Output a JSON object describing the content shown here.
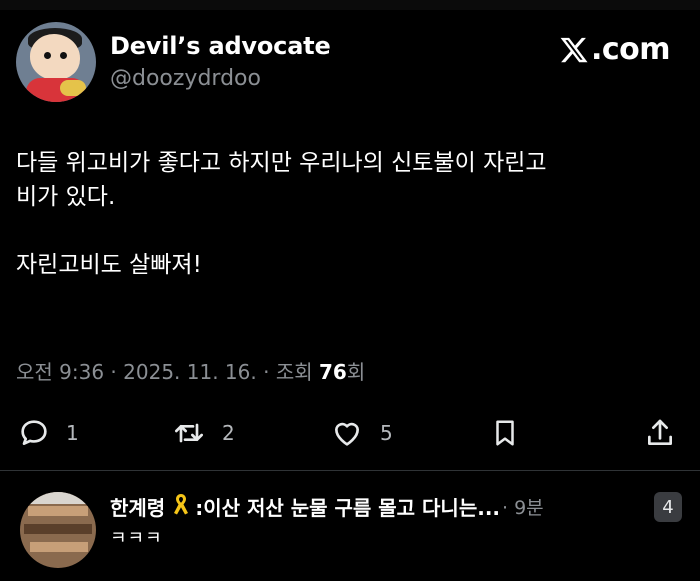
{
  "author": {
    "display_name": "Devil’s advocate",
    "handle": "@doozydrdoo"
  },
  "brand": {
    "logo": "x-logo-icon",
    "suffix": ".com"
  },
  "tweet": {
    "lines": [
      "다들 위고비가 좋다고 하지만 우리나의 신토불이 자린고",
      "비가 있다.",
      "자린고비도 살빠져!"
    ]
  },
  "meta": {
    "time": "오전 9:36",
    "sep1": " · ",
    "date": "2025. 11. 16.",
    "sep2": " · ",
    "views_prefix": "조회 ",
    "views_count": "76",
    "views_suffix": "회"
  },
  "actions": {
    "reply": {
      "icon": "comment-icon",
      "count": "1"
    },
    "retweet": {
      "icon": "retweet-icon",
      "count": "2"
    },
    "like": {
      "icon": "heart-icon",
      "count": "5"
    },
    "bookmark": {
      "icon": "bookmark-icon"
    },
    "share": {
      "icon": "share-icon"
    }
  },
  "reply_preview": {
    "name": "한계령",
    "badge_icon": "yellow-ribbon-icon",
    "text_after_badge": ":이산 저산 눈물 구름 몰고 다니는...",
    "time": "· 9분",
    "body": "ㅋㅋㅋ",
    "count_badge": "4"
  },
  "colors": {
    "background": "#000000",
    "text_primary": "#ffffff",
    "text_secondary": "#8b8f94",
    "divider": "#2f3336",
    "ribbon": "#f5c518"
  }
}
